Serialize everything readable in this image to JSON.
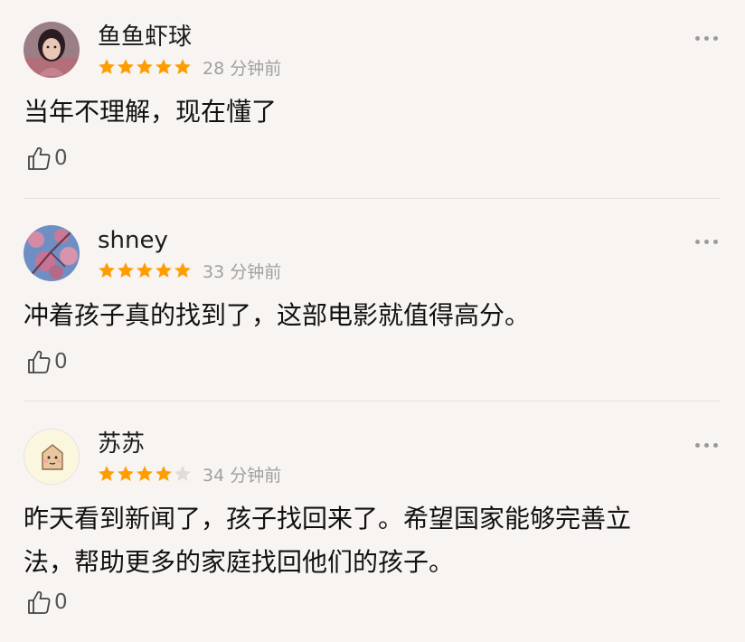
{
  "comments": [
    {
      "username": "鱼鱼虾球",
      "rating": 5,
      "max_rating": 5,
      "time": "28 分钟前",
      "content_lines": [
        "当年不理解，现在懂了"
      ],
      "likes": "0",
      "avatar_icon": "portrait-avatar"
    },
    {
      "username": "shney",
      "rating": 5,
      "max_rating": 5,
      "time": "33 分钟前",
      "content_lines": [
        "冲着孩子真的找到了，这部电影就值得高分。"
      ],
      "likes": "0",
      "avatar_icon": "blossom-avatar"
    },
    {
      "username": "苏苏",
      "rating": 4,
      "max_rating": 5,
      "time": "34 分钟前",
      "content_lines": [
        "昨天看到新闻了，孩子找回来了。希望国家能够完善立",
        "法，帮助更多的家庭找回他们的孩子。"
      ],
      "likes": "0",
      "avatar_icon": "cartoon-avatar"
    }
  ],
  "colors": {
    "star_filled": "#ff9d00",
    "star_empty": "#e0dcd9",
    "background": "#f8f4f2",
    "time_text": "#a0a0a0"
  }
}
